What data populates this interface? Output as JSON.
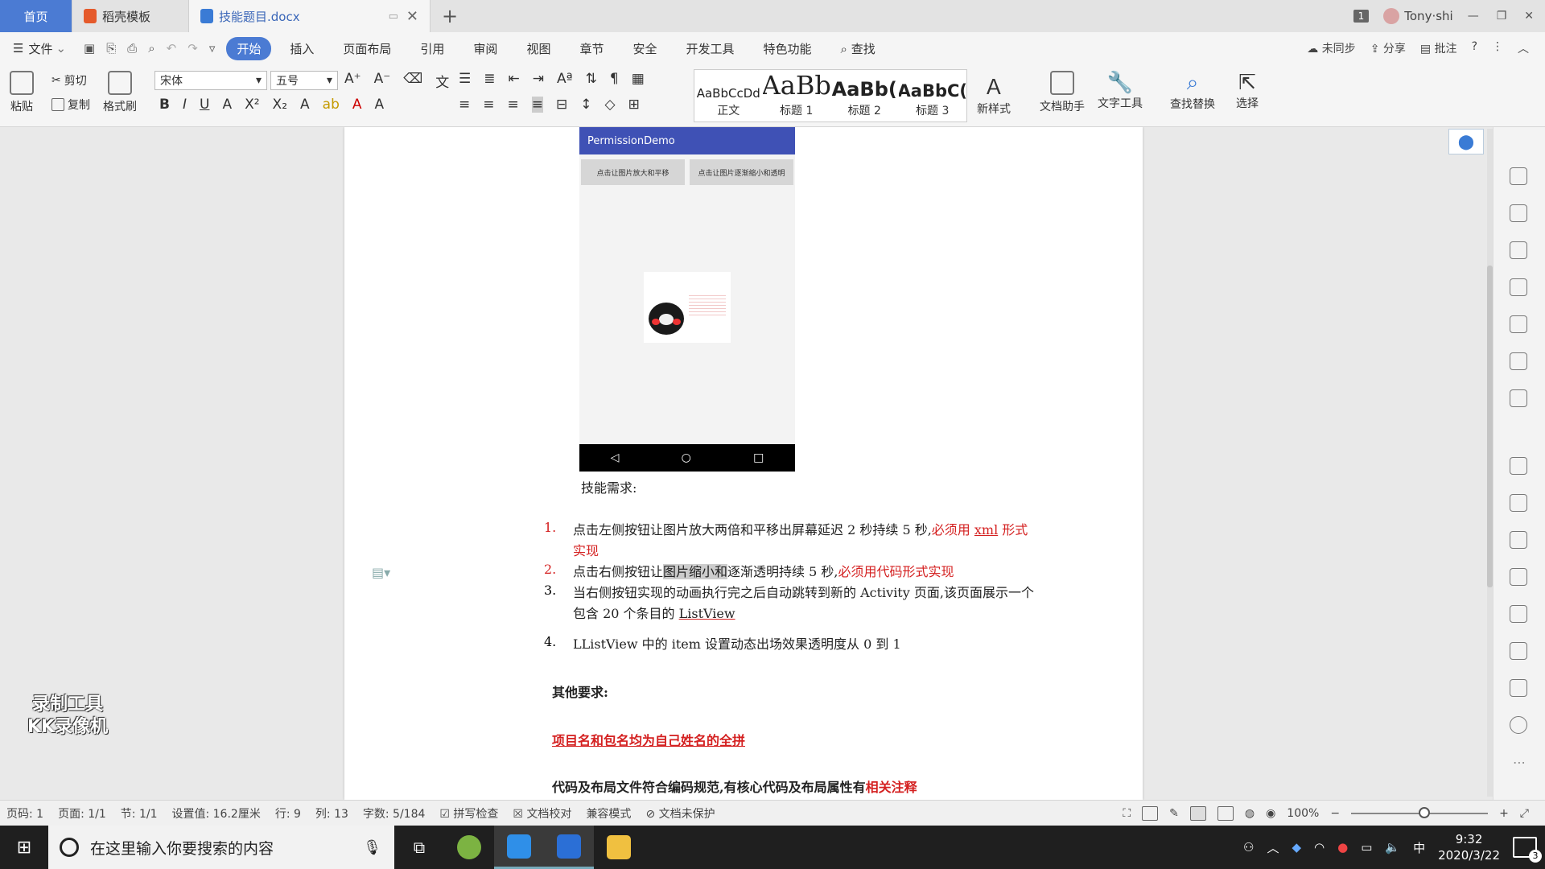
{
  "tabs": {
    "home": "首页",
    "template": "稻壳模板",
    "document": "技能题目.docx",
    "new_tab": "+"
  },
  "titlebar": {
    "badge": "1",
    "user": "Tony·shi",
    "min": "—",
    "restore": "❐",
    "close": "✕"
  },
  "menu": {
    "file": "文件",
    "tabs": [
      "开始",
      "插入",
      "页面布局",
      "引用",
      "审阅",
      "视图",
      "章节",
      "安全",
      "开发工具",
      "特色功能"
    ],
    "search": "查找",
    "sync": "未同步",
    "share": "分享",
    "comment": "批注",
    "help": "?"
  },
  "ribbon": {
    "paste": "粘贴",
    "cut": "剪切",
    "copy": "复制",
    "format_painter": "格式刷",
    "font_name": "宋体",
    "font_size": "五号",
    "styles": [
      {
        "sample": "AaBbCcDd",
        "label": "正文"
      },
      {
        "sample": "AaBb",
        "label": "标题 1"
      },
      {
        "sample": "AaBb(",
        "label": "标题 2"
      },
      {
        "sample": "AaBbC(",
        "label": "标题 3"
      }
    ],
    "new_style": "新样式",
    "doc_helper": "文档助手",
    "text_tools": "文字工具",
    "find_replace": "查找替换",
    "select": "选择"
  },
  "phone": {
    "app_title": "PermissionDemo",
    "btn_left": "点击让图片放大和平移",
    "btn_right": "点击让图片逐渐缩小和透明",
    "nav_back": "◁",
    "nav_home": "○",
    "nav_recent": "□"
  },
  "document": {
    "heading": "技能需求:",
    "items": [
      {
        "num": "1.",
        "a": "点击左侧按钮让图片放大两倍和平移出屏幕延迟 2 秒持续 5 秒,",
        "red": "必须用 ",
        "red_ul": "xml",
        "red2": " 形式",
        "cont": "实现"
      },
      {
        "num": "2.",
        "a": "点击右侧按钮让",
        "hl": "图片缩小和",
        "b": "逐渐透明持续 5 秒,",
        "red": "必须用代码形式实现"
      },
      {
        "num": "3.",
        "a": "当右侧按钮实现的动画执行完之后自动跳转到新的 Activity 页面,该页面展示一个",
        "cont": "包含 20 个条目的 ",
        "ul": "ListView"
      },
      {
        "num": "4.",
        "a": "LListView 中的 item 设置动态出场效果透明度从 0 到 1"
      }
    ],
    "other_heading": "其他要求:",
    "req1": "项目名和包名均为自己姓名的全拼",
    "req2_a": "代码及布局文件符合编码规范,有核心代码及布局属性有",
    "req2_red": "相关注释"
  },
  "watermark": {
    "line1": "录制工具",
    "line2": "KK录像机"
  },
  "status": {
    "page": "页码: 1",
    "pages": "页面: 1/1",
    "section": "节: 1/1",
    "setting": "设置值: 16.2厘米",
    "row": "行: 9",
    "col": "列: 13",
    "words": "字数: 5/184",
    "spell": "拼写检查",
    "proof": "文档校对",
    "compat": "兼容模式",
    "protect": "文档未保护",
    "zoom": "100%"
  },
  "taskbar": {
    "search_placeholder": "在这里输入你要搜索的内容",
    "ime": "中",
    "time": "9:32",
    "date": "2020/3/22",
    "notifications": "3"
  },
  "colors": {
    "accent": "#4b7bd3",
    "phone_bar": "#3f51b5",
    "required_red": "#d42020"
  }
}
